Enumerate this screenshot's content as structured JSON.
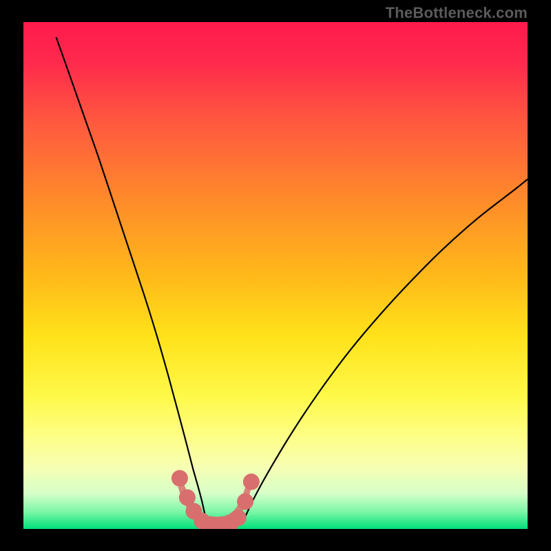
{
  "watermark": "TheBottleneck.com",
  "chart_data": {
    "type": "line",
    "title": "",
    "xlabel": "",
    "ylabel": "",
    "xlim": [
      0,
      100
    ],
    "ylim": [
      0,
      100
    ],
    "background_gradient_stops": [
      {
        "offset": 0.0,
        "color": "#ff1a4d"
      },
      {
        "offset": 0.08,
        "color": "#ff2a4d"
      },
      {
        "offset": 0.2,
        "color": "#ff5a3f"
      },
      {
        "offset": 0.35,
        "color": "#ff8a2a"
      },
      {
        "offset": 0.5,
        "color": "#ffb91a"
      },
      {
        "offset": 0.62,
        "color": "#ffe21a"
      },
      {
        "offset": 0.74,
        "color": "#fff94a"
      },
      {
        "offset": 0.82,
        "color": "#fdff88"
      },
      {
        "offset": 0.88,
        "color": "#f6ffb4"
      },
      {
        "offset": 0.93,
        "color": "#d6ffc8"
      },
      {
        "offset": 0.965,
        "color": "#7ff7a8"
      },
      {
        "offset": 1.0,
        "color": "#00e07a"
      }
    ],
    "series": [
      {
        "name": "left-curve",
        "stroke": "#000000",
        "x": [
          6.5,
          9.0,
          12.0,
          15.0,
          18.0,
          21.0,
          24.0,
          26.5,
          28.8,
          30.7,
          32.3,
          33.6,
          34.6,
          35.4,
          35.9,
          36.3
        ],
        "values": [
          97.0,
          90.0,
          81.5,
          73.0,
          64.0,
          55.0,
          46.0,
          38.0,
          30.0,
          23.0,
          17.0,
          12.0,
          8.5,
          5.5,
          3.3,
          2.0
        ]
      },
      {
        "name": "right-curve",
        "stroke": "#000000",
        "x": [
          43.8,
          44.5,
          45.6,
          47.3,
          49.6,
          52.5,
          56.0,
          60.2,
          65.0,
          70.5,
          76.5,
          83.0,
          90.0,
          97.5,
          100.0
        ],
        "values": [
          2.0,
          3.5,
          5.8,
          9.0,
          13.0,
          17.8,
          23.2,
          29.2,
          35.5,
          42.0,
          48.5,
          55.0,
          61.2,
          67.0,
          69.0
        ]
      },
      {
        "name": "marker-band",
        "stroke": "#e06a6a",
        "fill_opacity": 0.85,
        "x": [
          30.8,
          32.8,
          34.5,
          36.5,
          38.0,
          40.0,
          42.0,
          43.5,
          45.0
        ],
        "values": [
          9.5,
          5.0,
          2.5,
          1.0,
          0.8,
          1.0,
          2.3,
          5.2,
          9.0
        ]
      }
    ],
    "markers": {
      "color": "#d86e6e",
      "points": [
        {
          "x": 31.0,
          "y": 10.0
        },
        {
          "x": 32.5,
          "y": 6.2
        },
        {
          "x": 33.8,
          "y": 3.5
        },
        {
          "x": 35.4,
          "y": 1.6
        },
        {
          "x": 37.2,
          "y": 0.9
        },
        {
          "x": 39.1,
          "y": 0.8
        },
        {
          "x": 41.0,
          "y": 1.0
        },
        {
          "x": 42.6,
          "y": 2.2
        },
        {
          "x": 44.0,
          "y": 5.4
        },
        {
          "x": 45.2,
          "y": 9.3
        }
      ],
      "radius_px": 12
    }
  }
}
